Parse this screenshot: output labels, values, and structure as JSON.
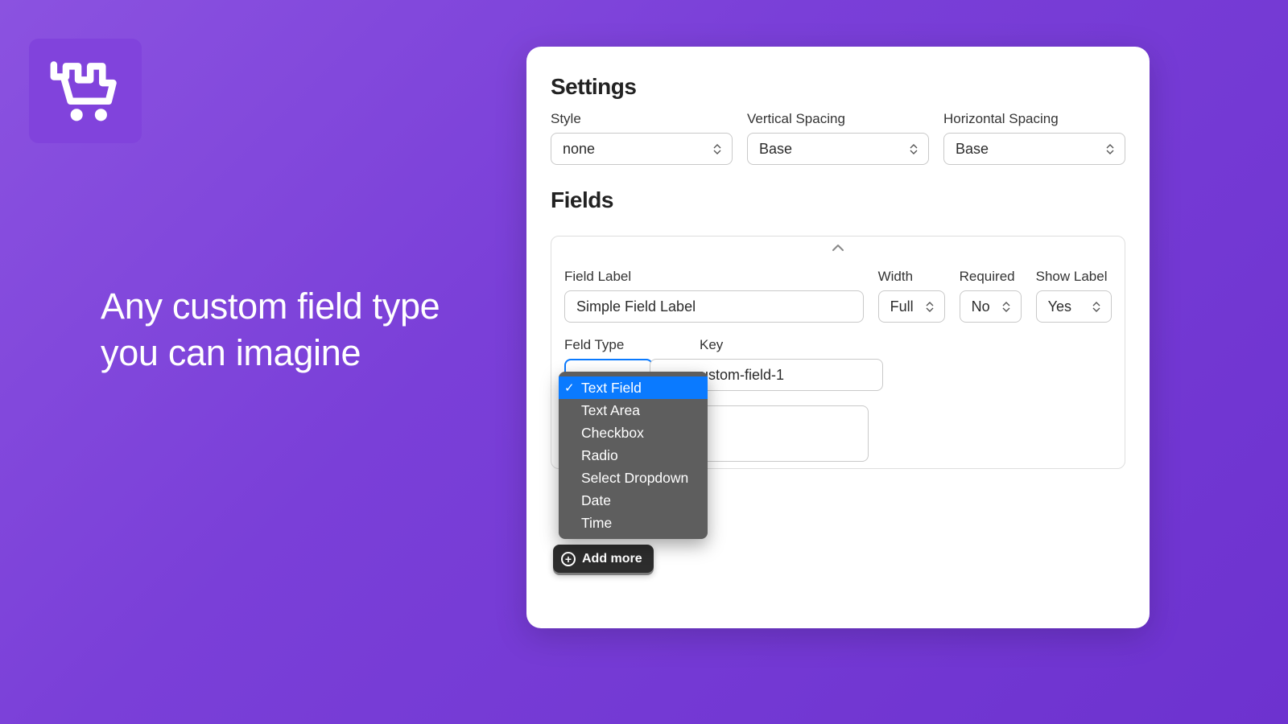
{
  "hero": {
    "line1": "Any custom field type",
    "line2": "you can imagine"
  },
  "panel": {
    "settings_title": "Settings",
    "fields_title": "Fields",
    "style_label": "Style",
    "style_value": "none",
    "vspacing_label": "Vertical Spacing",
    "vspacing_value": "Base",
    "hspacing_label": "Horizontal Spacing",
    "hspacing_value": "Base"
  },
  "field": {
    "label_label": "Field Label",
    "label_value": "Simple Field Label",
    "width_label": "Width",
    "width_value": "Full",
    "required_label": "Required",
    "required_value": "No",
    "showlabel_label": "Show Label",
    "showlabel_value": "Yes",
    "type_label": "Feld Type",
    "key_label": "Key",
    "key_value": "ustom-field-1"
  },
  "dropdown": {
    "options": [
      "Text Field",
      "Text Area",
      "Checkbox",
      "Radio",
      "Select Dropdown",
      "Date",
      "Time"
    ],
    "selected_index": 0
  },
  "add_more_label": "Add more"
}
